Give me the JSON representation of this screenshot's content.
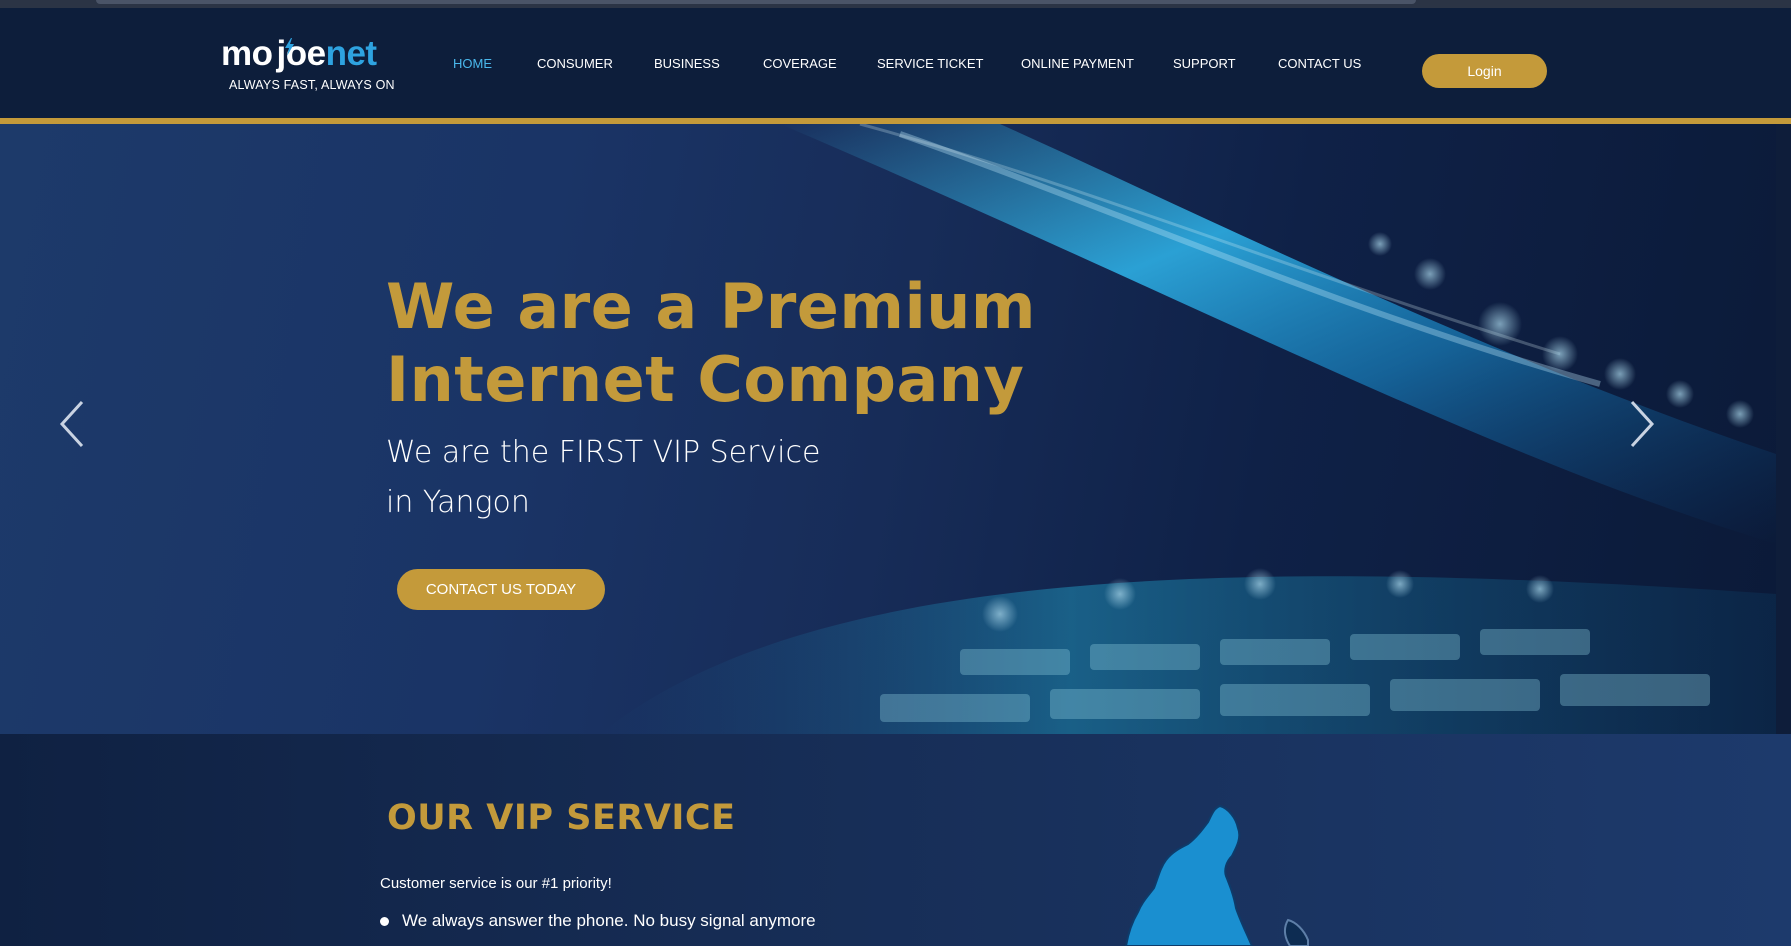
{
  "brand": {
    "name_main": "mo",
    "name_joe": "joe",
    "name_net": "net",
    "tagline": "ALWAYS FAST, ALWAYS ON"
  },
  "nav": {
    "items": [
      {
        "label": "HOME",
        "active": true
      },
      {
        "label": "CONSUMER",
        "active": false
      },
      {
        "label": "BUSINESS",
        "active": false
      },
      {
        "label": "COVERAGE",
        "active": false
      },
      {
        "label": "SERVICE TICKET",
        "active": false
      },
      {
        "label": "ONLINE PAYMENT",
        "active": false
      },
      {
        "label": "SUPPORT",
        "active": false
      },
      {
        "label": "CONTACT US",
        "active": false
      }
    ],
    "login_label": "Login"
  },
  "hero": {
    "title_line1": "We are a Premium",
    "title_line2": "Internet Company",
    "subtitle_line1": "We are the FIRST VIP Service",
    "subtitle_line2": "in Yangon",
    "cta_label": "CONTACT US TODAY",
    "prev_icon": "chevron-left-icon",
    "next_icon": "chevron-right-icon"
  },
  "vip": {
    "title": "OUR VIP SERVICE",
    "intro": "Customer service is our #1 priority!",
    "bullets": [
      "We always answer the phone. No busy signal anymore"
    ]
  },
  "colors": {
    "navy": "#0d1e3b",
    "gold": "#c49a3a",
    "accent_blue": "#4ab8ec",
    "logo_blue": "#2ea3e0",
    "map_blue": "#1a8fd0"
  }
}
